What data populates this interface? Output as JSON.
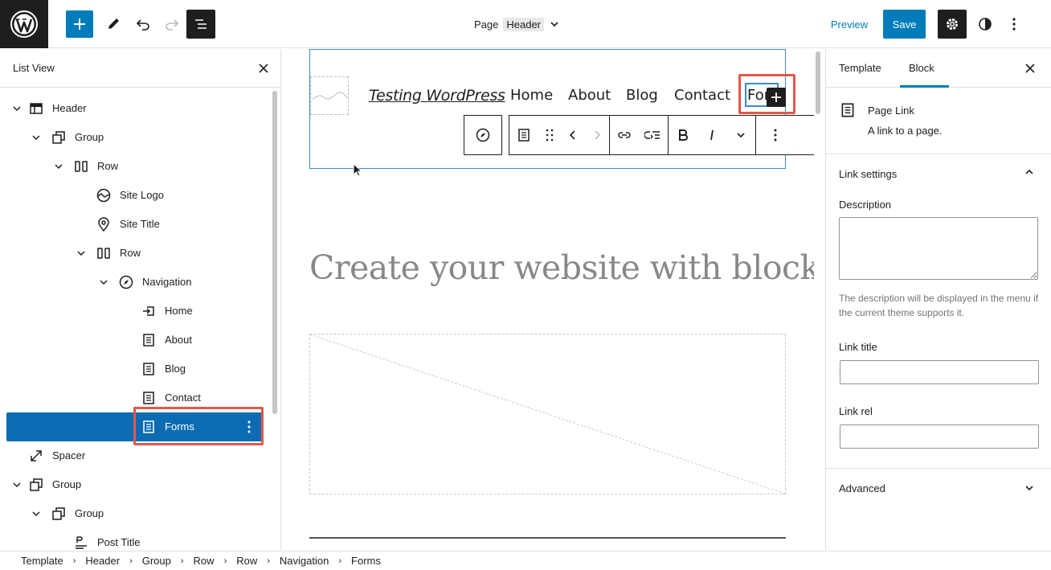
{
  "topbar": {
    "document_type": "Page",
    "document_name": "Header",
    "preview_label": "Preview",
    "save_label": "Save"
  },
  "list_view": {
    "title": "List View",
    "items": [
      {
        "label": "Header",
        "icon": "template-part-icon",
        "expanded": true
      },
      {
        "label": "Group",
        "icon": "group-icon",
        "expanded": true
      },
      {
        "label": "Row",
        "icon": "row-icon",
        "expanded": true
      },
      {
        "label": "Site Logo",
        "icon": "site-logo-icon"
      },
      {
        "label": "Site Title",
        "icon": "map-marker-icon"
      },
      {
        "label": "Row",
        "icon": "row-icon",
        "expanded": true
      },
      {
        "label": "Navigation",
        "icon": "compass-icon",
        "expanded": true
      },
      {
        "label": "Home",
        "icon": "home-link-icon"
      },
      {
        "label": "About",
        "icon": "page-icon"
      },
      {
        "label": "Blog",
        "icon": "page-icon"
      },
      {
        "label": "Contact",
        "icon": "page-icon"
      },
      {
        "label": "Forms",
        "icon": "page-icon",
        "selected": true
      },
      {
        "label": "Spacer",
        "icon": "resize-icon"
      },
      {
        "label": "Group",
        "icon": "group-icon",
        "expanded": true
      },
      {
        "label": "Group",
        "icon": "group-icon",
        "expanded": true
      },
      {
        "label": "Post Title",
        "icon": "post-title-icon"
      }
    ]
  },
  "canvas": {
    "site_title": "Testing WordPress",
    "nav_items": [
      "Home",
      "About",
      "Blog",
      "Contact"
    ],
    "nav_editing_text": "For",
    "headline": "Create your website with blocks"
  },
  "sidebar": {
    "tabs": [
      "Template",
      "Block"
    ],
    "active_tab": "Block",
    "block_name": "Page Link",
    "block_description": "A link to a page.",
    "link_settings": {
      "title": "Link settings",
      "description_label": "Description",
      "description_value": "",
      "description_help": "The description will be displayed in the menu if the current theme supports it.",
      "link_title_label": "Link title",
      "link_title_value": "",
      "link_rel_label": "Link rel",
      "link_rel_value": ""
    },
    "advanced_label": "Advanced"
  },
  "breadcrumb": [
    "Template",
    "Header",
    "Group",
    "Row",
    "Row",
    "Navigation",
    "Forms"
  ],
  "colors": {
    "accent": "#007cba",
    "selected_row": "#0c6cb3",
    "highlight_box": "#e0584b"
  }
}
